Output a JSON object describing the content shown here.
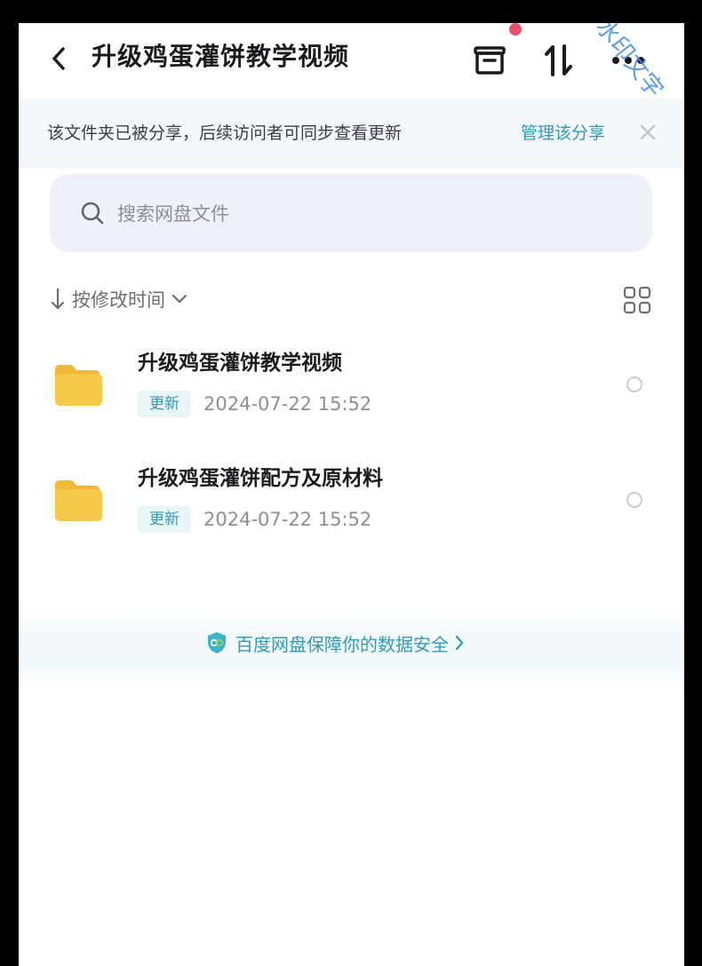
{
  "header": {
    "title": "升级鸡蛋灌饼教学视频",
    "watermark": "水印文字"
  },
  "banner": {
    "text": "该文件夹已被分享，后续访问者可同步查看更新",
    "link": "管理该分享"
  },
  "search": {
    "placeholder": "搜索网盘文件",
    "value": ""
  },
  "sort": {
    "label": "按修改时间"
  },
  "files": [
    {
      "name": "升级鸡蛋灌饼教学视频",
      "badge": "更新",
      "date": "2024-07-22  15:52"
    },
    {
      "name": "升级鸡蛋灌饼配方及原材料",
      "badge": "更新",
      "date": "2024-07-22  15:52"
    }
  ],
  "footer": {
    "security_text": "百度网盘保障你的数据安全"
  },
  "colors": {
    "accent": "#2e9bb8",
    "folder": "#f7c948",
    "dot": "#e9506a",
    "watermark": "#4a90e2"
  }
}
